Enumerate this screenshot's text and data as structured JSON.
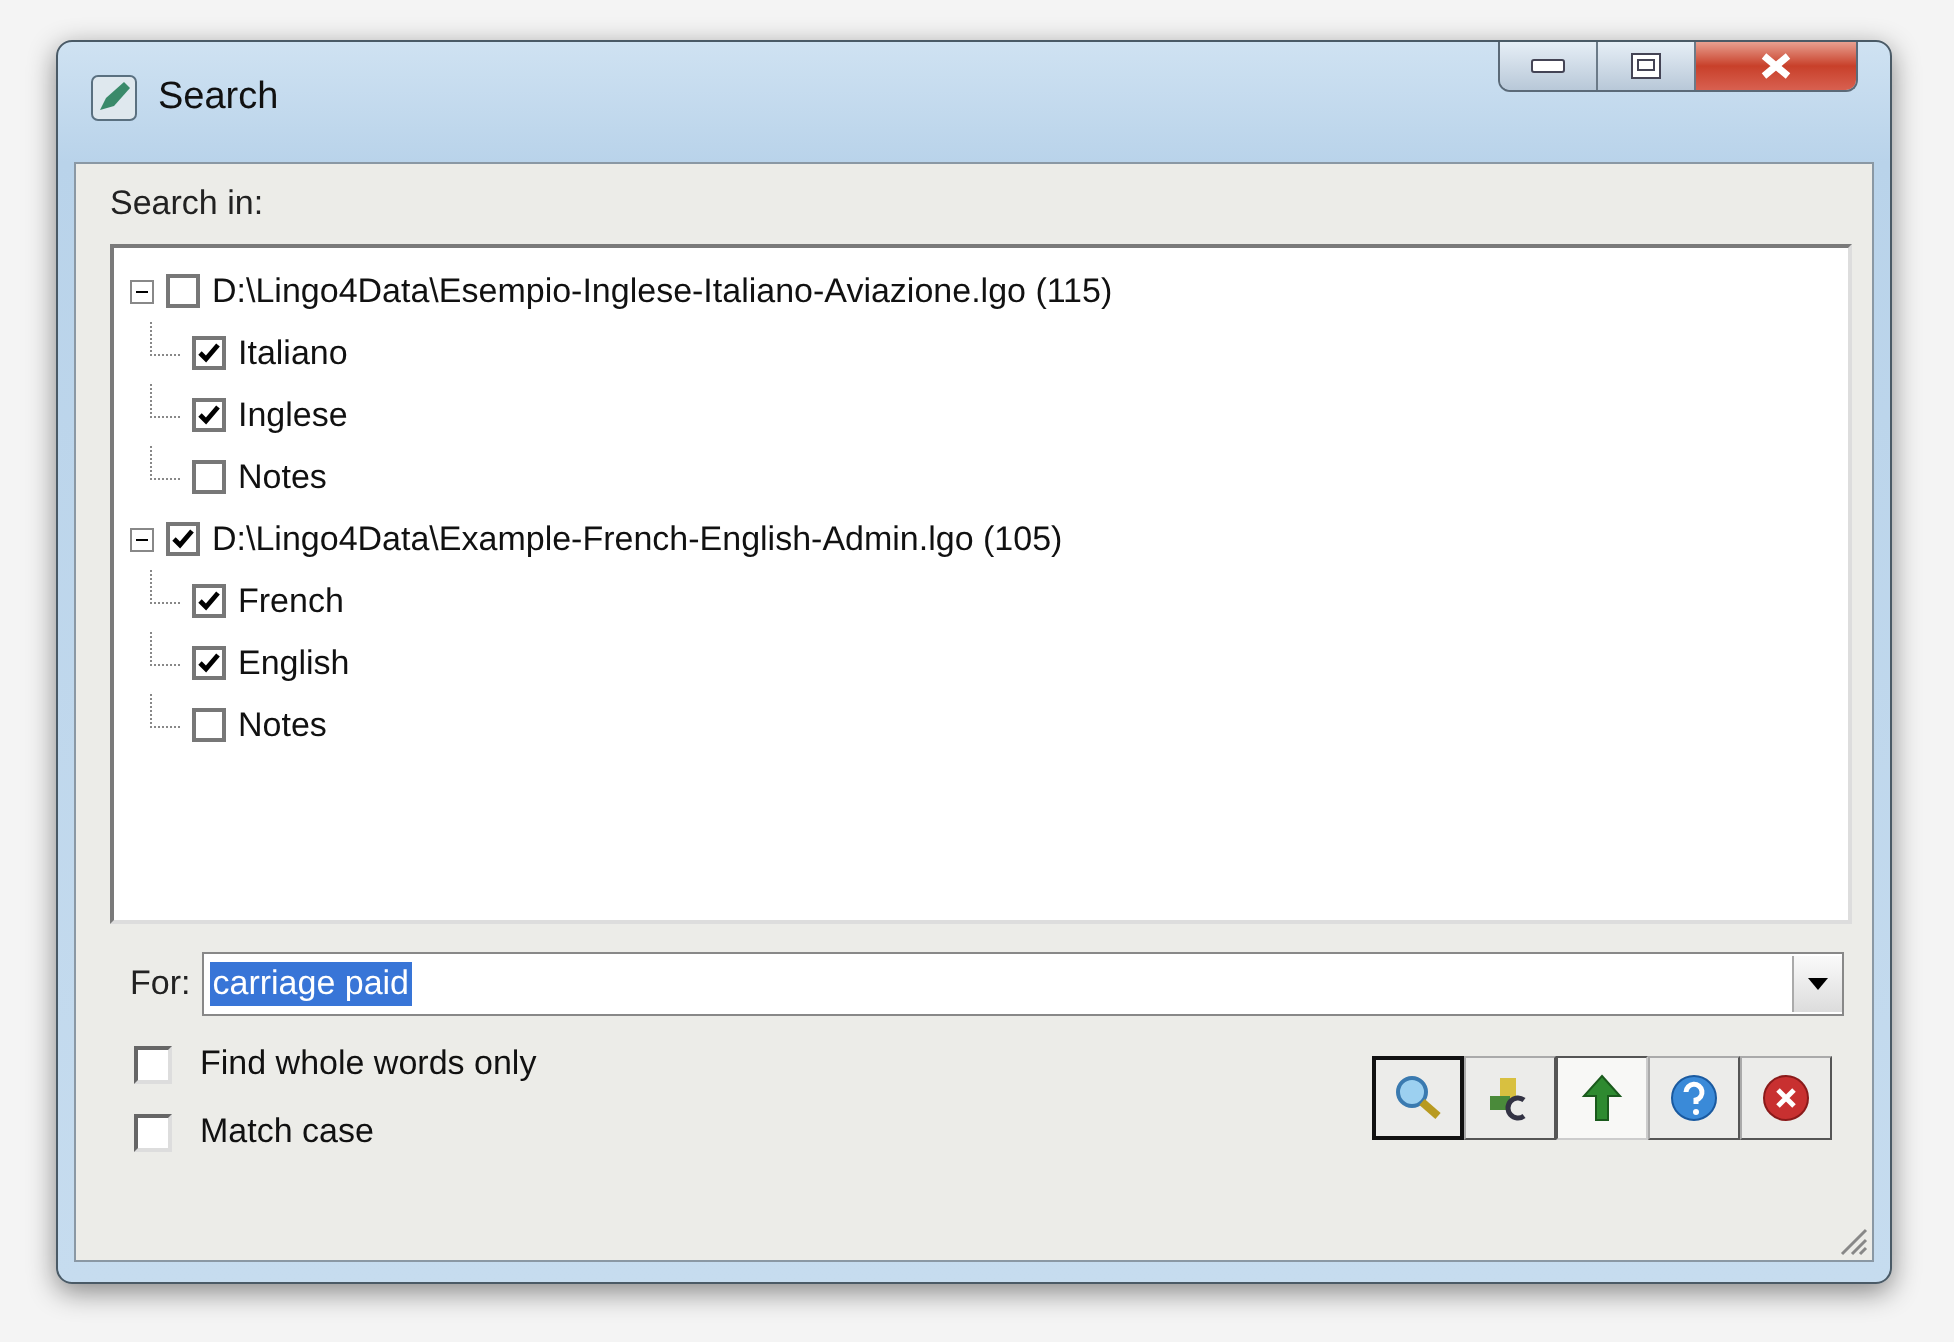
{
  "window": {
    "title": "Search"
  },
  "search_in": {
    "label": "Search in:",
    "tree": [
      {
        "label": "D:\\Lingo4Data\\Esempio-Inglese-Italiano-Aviazione.lgo (115)",
        "checked": false,
        "expanded": true,
        "children": [
          {
            "label": "Italiano",
            "checked": true
          },
          {
            "label": "Inglese",
            "checked": true
          },
          {
            "label": "Notes",
            "checked": false
          }
        ]
      },
      {
        "label": "D:\\Lingo4Data\\Example-French-English-Admin.lgo (105)",
        "checked": true,
        "expanded": true,
        "children": [
          {
            "label": "French",
            "checked": true
          },
          {
            "label": "English",
            "checked": true
          },
          {
            "label": "Notes",
            "checked": false
          }
        ]
      }
    ]
  },
  "for_field": {
    "label": "For:",
    "value": "carriage paid",
    "selected": true
  },
  "options": [
    {
      "label": "Find whole words only",
      "checked": false
    },
    {
      "label": "Match case",
      "checked": false
    }
  ],
  "toolbar": [
    {
      "kind": "search",
      "default": true,
      "pressed": false
    },
    {
      "kind": "replace",
      "default": false,
      "pressed": false
    },
    {
      "kind": "up",
      "default": false,
      "pressed": true
    },
    {
      "kind": "help",
      "default": false,
      "pressed": false
    },
    {
      "kind": "close",
      "default": false,
      "pressed": false
    }
  ]
}
